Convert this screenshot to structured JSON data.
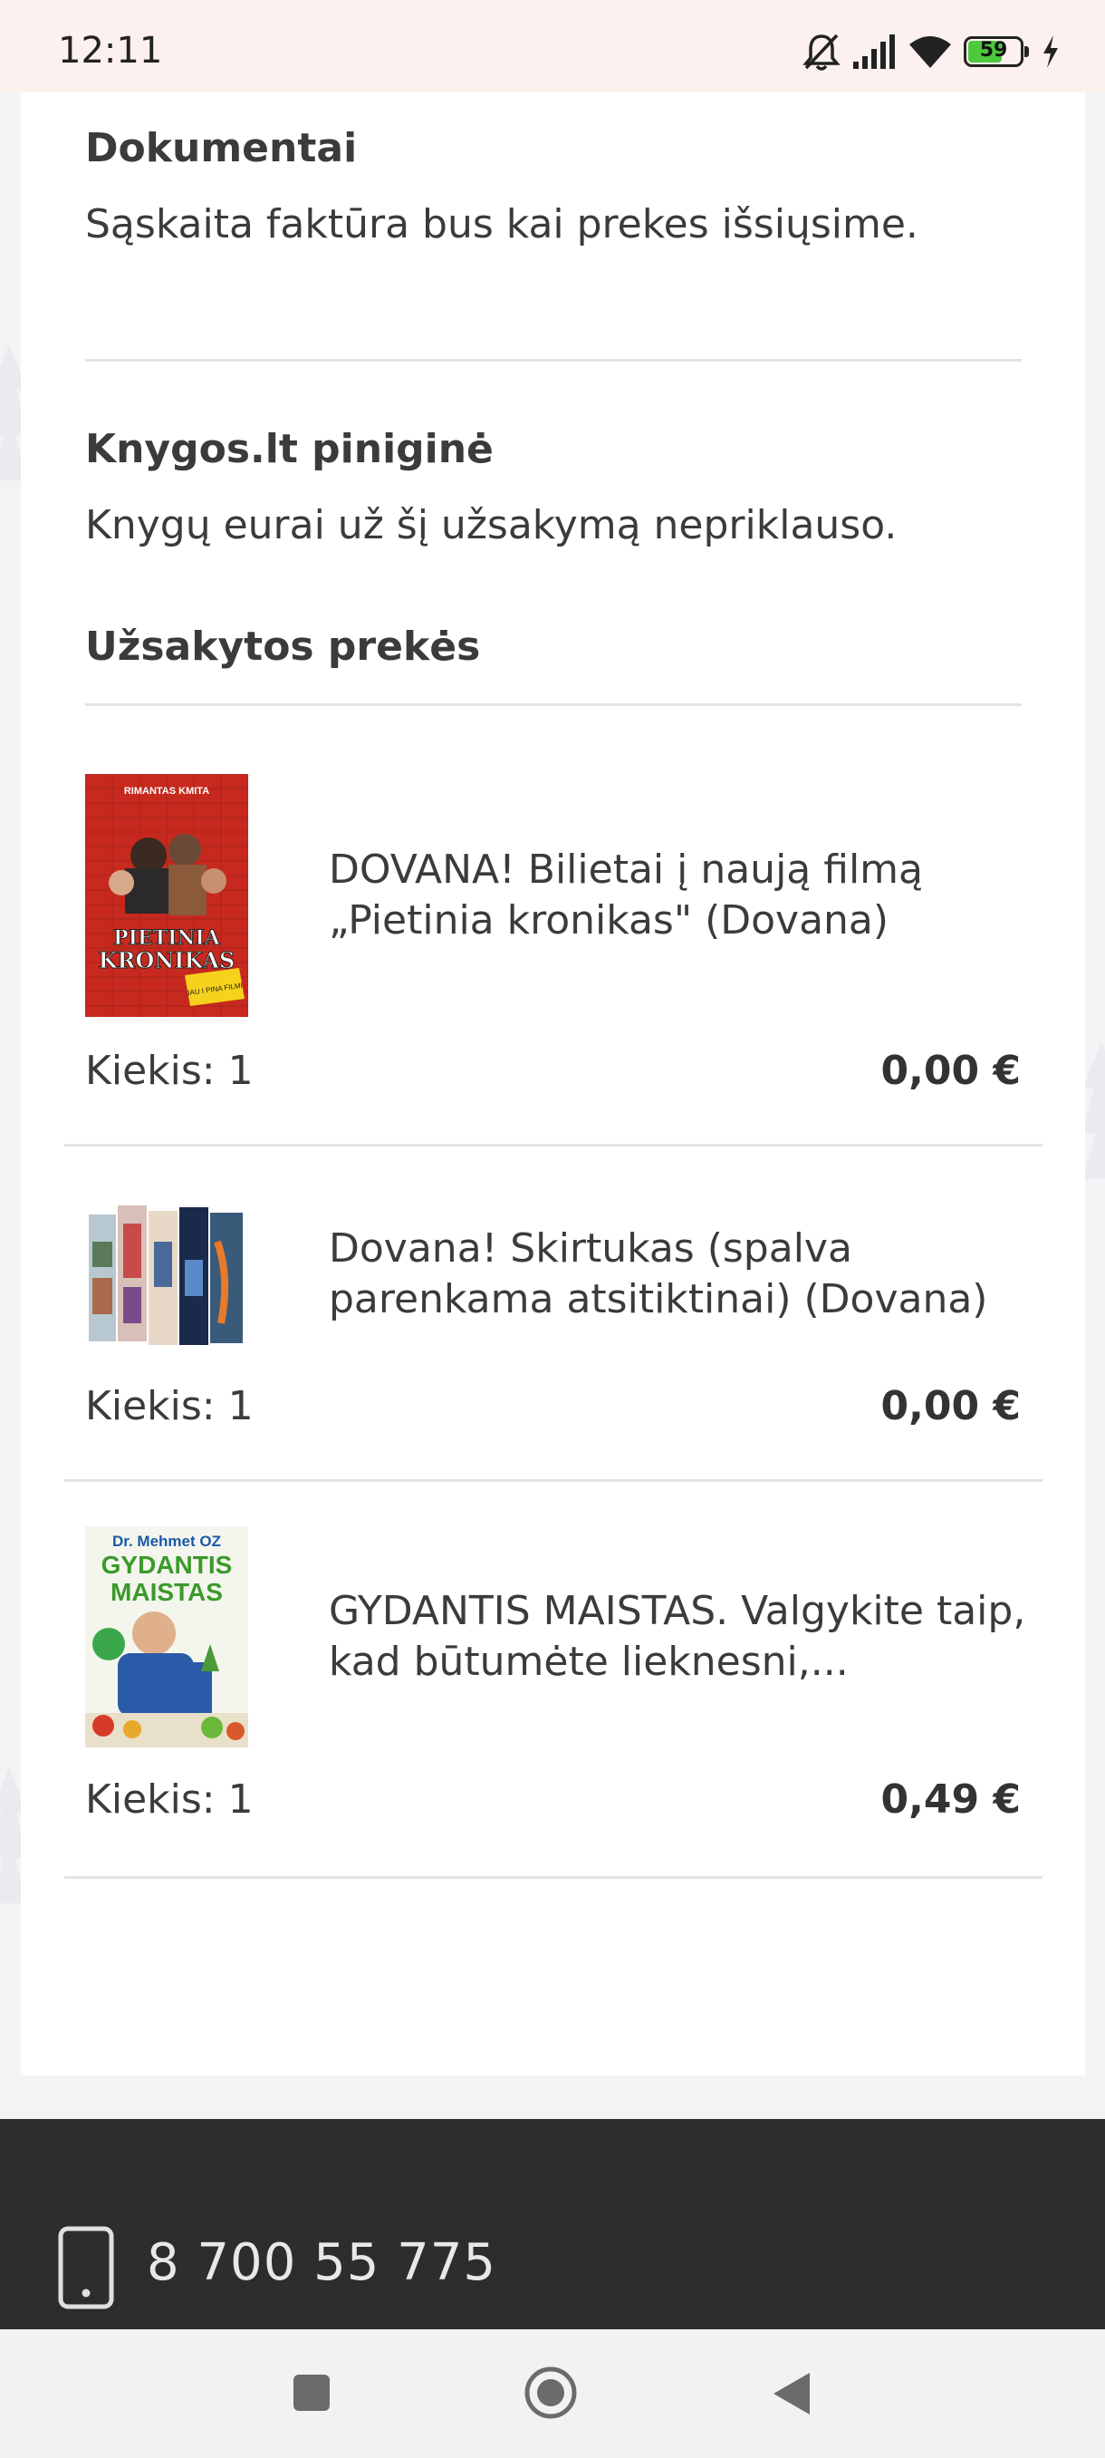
{
  "status_bar": {
    "time": "12:11",
    "battery_percent": "59",
    "icons": [
      "bell-off-icon",
      "signal-icon",
      "wifi-icon",
      "battery-icon",
      "charging-icon"
    ]
  },
  "documents": {
    "title": "Dokumentai",
    "text": "Sąskaita faktūra bus kai prekes išsiųsime."
  },
  "wallet": {
    "title": "Knygos.lt piniginė",
    "text": "Knygų eurai už šį užsakymą nepriklauso."
  },
  "ordered_items": {
    "title": "Užsakytos prekės",
    "items": [
      {
        "title": "DOVANA! Bilietai į naują filmą „Pietinia kronikas\" (Dovana)",
        "quantity": "Kiekis: 1",
        "price": "0,00 €",
        "cover": {
          "author": "RIMANTAS KMITA",
          "name_line1": "PIETINIA",
          "name_line2": "KRONIKAS",
          "sticker": "JAU I PINA FILMI"
        }
      },
      {
        "title": "Dovana! Skirtukas (spalva parenkama atsitiktinai) (Dovana)",
        "quantity": "Kiekis: 1",
        "price": "0,00 €"
      },
      {
        "title": "GYDANTIS MAISTAS. Valgykite taip, kad būtumėte lieknesni,...",
        "quantity": "Kiekis: 1",
        "price": "0,49 €",
        "cover": {
          "author": "Dr. Mehmet OZ",
          "name_line1": "GYDANTIS",
          "name_line2": "MAISTAS"
        }
      }
    ]
  },
  "footer": {
    "phone": "8 700 55 775"
  },
  "colors": {
    "background": "#f2f3f5",
    "card": "#ffffff",
    "footer": "#2d2d2e",
    "text": "#3b3b3b"
  }
}
